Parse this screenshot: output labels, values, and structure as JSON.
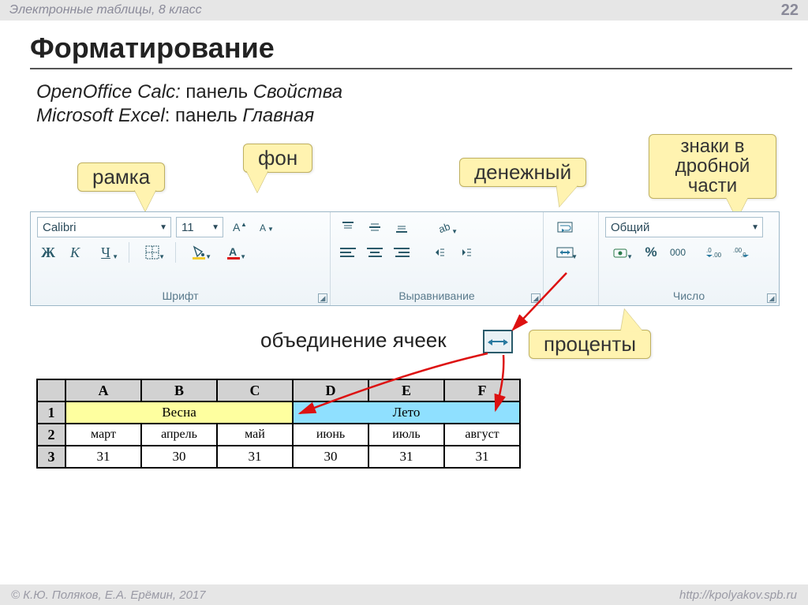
{
  "header": {
    "left": "Электронные таблицы, 8 класс",
    "page": "22"
  },
  "title": "Форматирование",
  "desc": {
    "l1a": "OpenOffice Calc:",
    "l1b": " панель ",
    "l1c": "Свойства",
    "l2a": "Microsoft Excel",
    "l2b": ": панель ",
    "l2c": "Главная"
  },
  "callouts": {
    "border": "рамка",
    "fill": "фон",
    "currency": "денежный",
    "decimals1": "знаки в",
    "decimals2": "дробной",
    "decimals3": "части",
    "percent": "проценты"
  },
  "ribbon": {
    "font_name": "Calibri",
    "font_size": "11",
    "format_name": "Общий",
    "sections": {
      "font": "Шрифт",
      "align": "Выравнивание",
      "number": "Число"
    },
    "bold": "Ж",
    "italic": "К",
    "underline": "Ч",
    "thousands": "000",
    "percent_sign": "%"
  },
  "merge_label": "объединение ячеек",
  "sheet": {
    "cols": [
      "A",
      "B",
      "C",
      "D",
      "E",
      "F"
    ],
    "rows": [
      "1",
      "2",
      "3"
    ],
    "spring": "Весна",
    "summer": "Лето",
    "months": [
      "март",
      "апрель",
      "май",
      "июнь",
      "июль",
      "август"
    ],
    "days": [
      "31",
      "30",
      "31",
      "30",
      "31",
      "31"
    ]
  },
  "footer": {
    "left": "© К.Ю. Поляков, Е.А. Ерёмин, 2017",
    "right": "http://kpolyakov.spb.ru"
  }
}
